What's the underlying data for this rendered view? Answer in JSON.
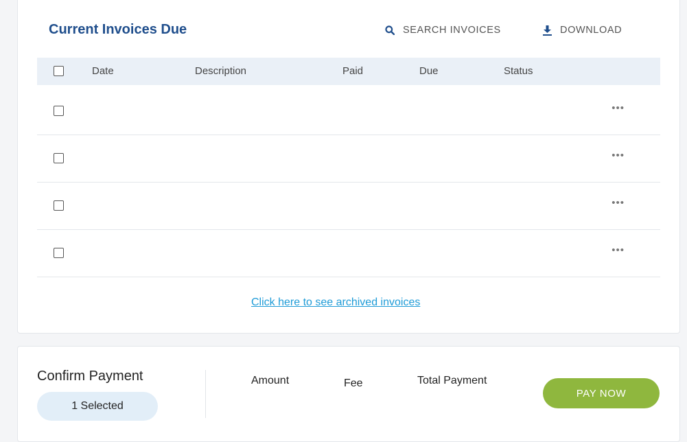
{
  "invoices": {
    "title": "Current Invoices Due",
    "search_label": "SEARCH INVOICES",
    "download_label": "DOWNLOAD",
    "columns": [
      "Date",
      "Description",
      "Paid",
      "Due",
      "Status"
    ],
    "row_menu_label": "•••",
    "archived_link": "Click here to see archived invoices"
  },
  "payment": {
    "title": "Confirm Payment",
    "selected_badge": "1 Selected",
    "amount_label": "Amount",
    "fee_label": "Fee",
    "total_label": "Total Payment",
    "pay_button": "PAY NOW"
  },
  "colors": {
    "title_blue": "#1f4e8c",
    "link_blue": "#1e9bd7",
    "header_bg": "#eaf0f7",
    "pay_green": "#8fb73e",
    "pill_bg": "#e2eef8"
  },
  "icons": {
    "search": "search-icon",
    "download": "download-icon"
  }
}
